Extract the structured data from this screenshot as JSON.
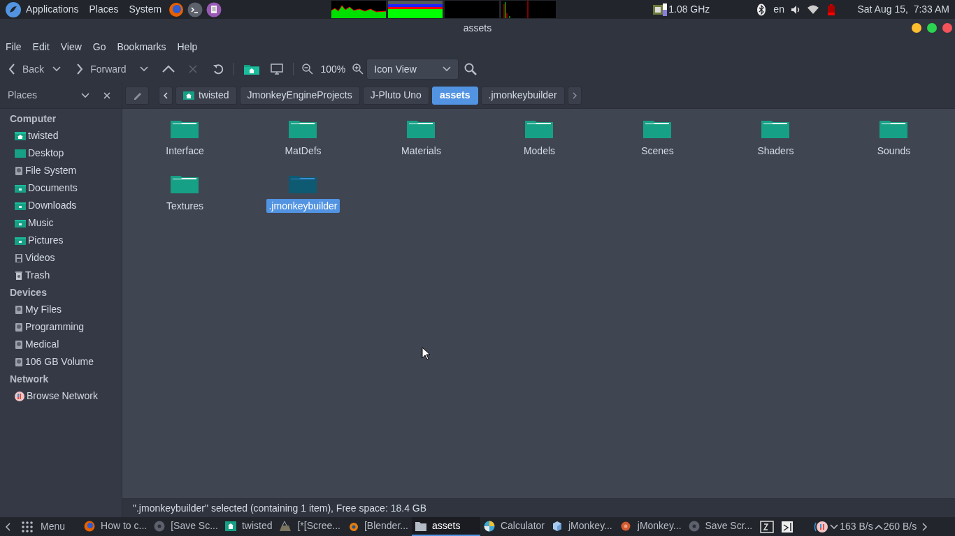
{
  "top_panel": {
    "menus": [
      "Applications",
      "Places",
      "System"
    ],
    "cpu_freq": "1.08 GHz",
    "keyboard_layout": "en",
    "clock": "Sat Aug 15,  7:33 AM"
  },
  "window": {
    "title": "assets"
  },
  "menu_bar": [
    "File",
    "Edit",
    "View",
    "Go",
    "Bookmarks",
    "Help"
  ],
  "toolbar": {
    "back": "Back",
    "forward": "Forward",
    "zoom": "100%",
    "view_mode": "Icon View"
  },
  "sidebar": {
    "title": "Places",
    "sections": [
      {
        "heading": "Computer",
        "items": [
          {
            "label": "twisted",
            "kind": "home"
          },
          {
            "label": "Desktop",
            "kind": "desktop"
          },
          {
            "label": "File System",
            "kind": "drive"
          },
          {
            "label": "Documents",
            "kind": "folder"
          },
          {
            "label": "Downloads",
            "kind": "folder"
          },
          {
            "label": "Music",
            "kind": "folder"
          },
          {
            "label": "Pictures",
            "kind": "folder"
          },
          {
            "label": "Videos",
            "kind": "film"
          },
          {
            "label": "Trash",
            "kind": "trash"
          }
        ]
      },
      {
        "heading": "Devices",
        "items": [
          {
            "label": "My Files",
            "kind": "drive"
          },
          {
            "label": "Programming",
            "kind": "drive"
          },
          {
            "label": "Medical",
            "kind": "drive"
          },
          {
            "label": "106 GB Volume",
            "kind": "drive"
          }
        ]
      },
      {
        "heading": "Network",
        "items": [
          {
            "label": "Browse Network",
            "kind": "network"
          }
        ]
      }
    ]
  },
  "path_bar": [
    {
      "label": "twisted",
      "selected": false,
      "home": true
    },
    {
      "label": "JmonkeyEngineProjects",
      "selected": false,
      "home": false
    },
    {
      "label": "J-Pluto Uno",
      "selected": false,
      "home": false
    },
    {
      "label": "assets",
      "selected": true,
      "home": false
    },
    {
      "label": ".jmonkeybuilder",
      "selected": false,
      "home": false
    }
  ],
  "files": [
    {
      "name": "Interface",
      "selected": false
    },
    {
      "name": "MatDefs",
      "selected": false
    },
    {
      "name": "Materials",
      "selected": false
    },
    {
      "name": "Models",
      "selected": false
    },
    {
      "name": "Scenes",
      "selected": false
    },
    {
      "name": "Shaders",
      "selected": false
    },
    {
      "name": "Sounds",
      "selected": false
    },
    {
      "name": "Textures",
      "selected": false
    },
    {
      "name": ".jmonkeybuilder",
      "selected": true
    }
  ],
  "status_bar": "\".jmonkeybuilder\" selected (containing 1 item), Free space: 18.4 GB",
  "taskbar": {
    "menu": "Menu",
    "tasks": [
      {
        "label": "How to c...",
        "kind": "firefox",
        "selected": false
      },
      {
        "label": "[Save Sc...",
        "kind": "disc",
        "selected": false
      },
      {
        "label": "twisted",
        "kind": "home",
        "selected": false
      },
      {
        "label": "[*[Scree...",
        "kind": "gimp",
        "selected": false
      },
      {
        "label": "[Blender...",
        "kind": "blender",
        "selected": false
      },
      {
        "label": "assets",
        "kind": "folder",
        "selected": true
      },
      {
        "label": "Calculator",
        "kind": "calc",
        "selected": false
      },
      {
        "label": "jMonkey...",
        "kind": "cube",
        "selected": false
      },
      {
        "label": "jMonkey...",
        "kind": "flower",
        "selected": false
      },
      {
        "label": "Save Scr...",
        "kind": "disc",
        "selected": false
      }
    ],
    "download": "163 B/s",
    "upload": "260 B/s"
  }
}
